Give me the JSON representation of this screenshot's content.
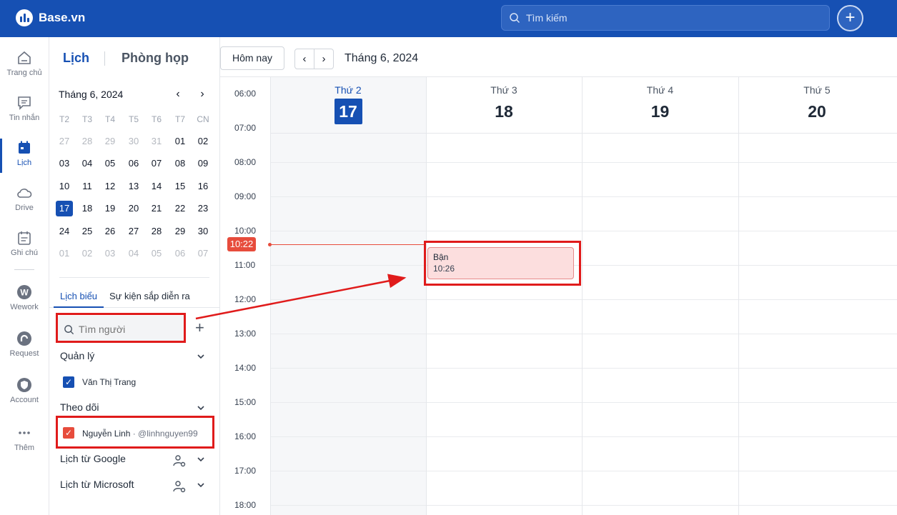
{
  "topbar": {
    "brand": "Base.vn",
    "search_placeholder": "Tìm kiếm",
    "add_label": "+"
  },
  "rail": {
    "items": [
      {
        "label": "Trang chủ",
        "icon": "home-icon"
      },
      {
        "label": "Tin nhắn",
        "icon": "message-icon"
      },
      {
        "label": "Lịch",
        "icon": "calendar-icon"
      },
      {
        "label": "Drive",
        "icon": "cloud-icon"
      },
      {
        "label": "Ghi chú",
        "icon": "note-icon"
      },
      {
        "label": "Wework",
        "icon": "wework-icon"
      },
      {
        "label": "Request",
        "icon": "request-icon"
      },
      {
        "label": "Account",
        "icon": "shield-icon"
      },
      {
        "label": "Thêm",
        "icon": "more-icon"
      }
    ]
  },
  "sidebar": {
    "tabs": {
      "calendar": "Lịch",
      "rooms": "Phòng họp"
    },
    "mini_calendar": {
      "title": "Tháng 6, 2024",
      "weekdays": [
        "T2",
        "T3",
        "T4",
        "T5",
        "T6",
        "T7",
        "CN"
      ],
      "weeks": [
        [
          "27",
          "28",
          "29",
          "30",
          "31",
          "01",
          "02"
        ],
        [
          "03",
          "04",
          "05",
          "06",
          "07",
          "08",
          "09"
        ],
        [
          "10",
          "11",
          "12",
          "13",
          "14",
          "15",
          "16"
        ],
        [
          "17",
          "18",
          "19",
          "20",
          "21",
          "22",
          "23"
        ],
        [
          "24",
          "25",
          "26",
          "27",
          "28",
          "29",
          "30"
        ],
        [
          "01",
          "02",
          "03",
          "04",
          "05",
          "06",
          "07"
        ]
      ],
      "today": "17"
    },
    "subtabs": {
      "active": "Lịch biểu",
      "other": "Sự kiện sắp diễn ra"
    },
    "people_search_placeholder": "Tìm người",
    "sections": {
      "manage": {
        "title": "Quản lý",
        "person": "Văn Thị Trang"
      },
      "follow": {
        "title": "Theo dõi",
        "person": "Nguyễn Linh",
        "handle": " · @linhnguyen99"
      },
      "google": {
        "title": "Lịch từ Google"
      },
      "microsoft": {
        "title": "Lịch từ Microsoft"
      }
    }
  },
  "calendar": {
    "today_button": "Hôm nay",
    "prev_label": "‹",
    "next_label": "›",
    "month_label": "Tháng 6, 2024",
    "days": [
      {
        "name": "Thứ 2",
        "num": "17",
        "today": true
      },
      {
        "name": "Thứ 3",
        "num": "18"
      },
      {
        "name": "Thứ 4",
        "num": "19"
      },
      {
        "name": "Thứ 5",
        "num": "20"
      }
    ],
    "hours": [
      "06:00",
      "07:00",
      "08:00",
      "09:00",
      "10:00",
      "11:00",
      "12:00",
      "13:00",
      "14:00",
      "15:00",
      "16:00",
      "17:00",
      "18:00"
    ],
    "now_time": "10:22",
    "event": {
      "title": "Bận",
      "time": "10:26"
    }
  },
  "colors": {
    "brand": "#1650b3",
    "now": "#e74c3c",
    "annotation": "#e01b1b",
    "event_bg": "#fcdede"
  }
}
